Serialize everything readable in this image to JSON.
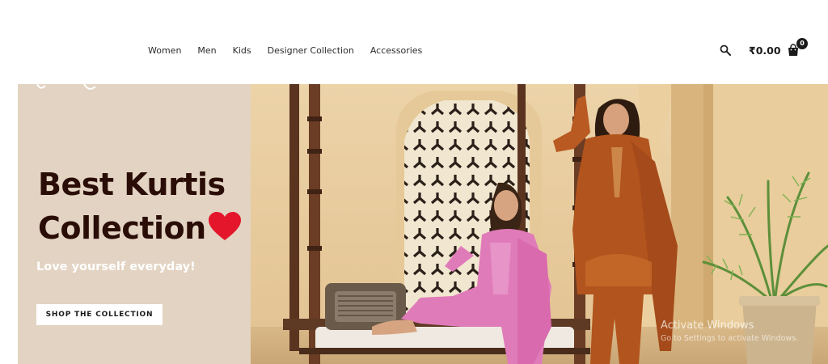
{
  "nav": {
    "items": [
      {
        "label": "Women"
      },
      {
        "label": "Men"
      },
      {
        "label": "Kids"
      },
      {
        "label": "Designer Collection"
      },
      {
        "label": "Accessories"
      }
    ]
  },
  "header": {
    "cart_total": "₹0.00",
    "cart_count": "0",
    "icons": [
      "search-icon",
      "shopping-bag-icon"
    ]
  },
  "hero": {
    "title_line1": "Best Kurtis",
    "title_line2": "Collection",
    "tagline": "Love yourself everyday!",
    "cta_label": "SHOP THE COLLECTION",
    "colors": {
      "panel_bg": "#e3d3c2",
      "title": "#2a0d07",
      "heart": "#e3162b",
      "tagline": "#ffffff",
      "button_bg": "#ffffff"
    }
  },
  "watermark": {
    "title": "Activate Windows",
    "subtitle": "Go to Settings to activate Windows."
  }
}
